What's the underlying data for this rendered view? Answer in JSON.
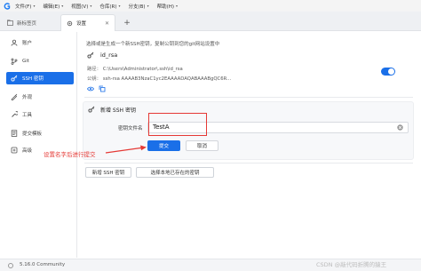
{
  "menubar": {
    "items": [
      {
        "label": "文件(F)"
      },
      {
        "label": "编辑(E)"
      },
      {
        "label": "视图(V)"
      },
      {
        "label": "仓库(R)"
      },
      {
        "label": "分支(B)"
      },
      {
        "label": "帮助(H)"
      }
    ]
  },
  "tabs": [
    {
      "label": "新标签页"
    },
    {
      "label": "设置"
    }
  ],
  "sidebar": {
    "items": [
      {
        "label": "账户",
        "icon": "account-icon"
      },
      {
        "label": "Git",
        "icon": "git-icon"
      },
      {
        "label": "SSH 密钥",
        "icon": "key-icon",
        "active": true
      },
      {
        "label": "外观",
        "icon": "appearance-icon"
      },
      {
        "label": "工具",
        "icon": "tools-icon"
      },
      {
        "label": "提交模板",
        "icon": "template-icon"
      },
      {
        "label": "高级",
        "icon": "advanced-icon"
      }
    ]
  },
  "content": {
    "intro": "选择或是生成一个新SSH密钥，复制公钥到您的git网站设置中",
    "key": {
      "name": "id_rsa",
      "path_label": "路径：",
      "path": "C:\\Users\\Administrator\\.ssh\\id_rsa",
      "pubkey_label": "公钥：",
      "pubkey": "ssh-rsa AAAAB3NzaC1yc2EAAAADAQABAAABgQC6R...",
      "enabled": true
    },
    "new_key": {
      "title": "新增 SSH 密钥",
      "filename_label": "密钥文件名",
      "filename_value": "TestA",
      "submit_label": "提交",
      "cancel_label": "取消"
    },
    "annotation": "设置名字后进行提交",
    "new_ssh_button": "新增 SSH 密钥",
    "pick_local_button": "选择本地已存在的密钥"
  },
  "status": {
    "version": "5.16.0 Community"
  },
  "watermark": "CSDN @敲代码折腾的猿王",
  "colors": {
    "accent": "#1a6fe8",
    "annotation": "#e53935"
  }
}
